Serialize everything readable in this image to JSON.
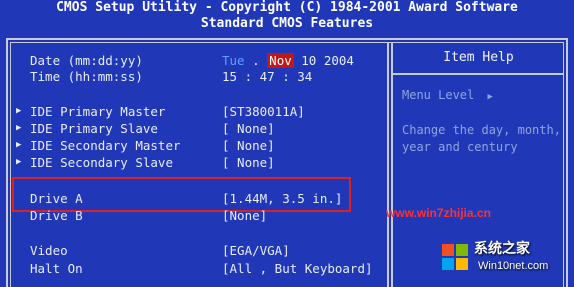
{
  "header": {
    "line1": "CMOS Setup Utility - Copyright (C) 1984-2001 Award Software",
    "line2": "Standard CMOS Features"
  },
  "settings": {
    "date_label": "Date (mm:dd:yy)",
    "date_day": "Tue",
    "date_month": "Nov",
    "date_rest": "10 2004",
    "time_label": "Time (hh:mm:ss)",
    "time_value": "15 : 47 : 34",
    "ide": [
      {
        "label": "IDE Primary Master",
        "value": "[ST380011A]"
      },
      {
        "label": "IDE Primary Slave",
        "value": "[ None]"
      },
      {
        "label": "IDE Secondary Master",
        "value": "[ None]"
      },
      {
        "label": "IDE Secondary Slave",
        "value": "[ None]"
      }
    ],
    "drive_a_label": "Drive A",
    "drive_a_value": "[1.44M, 3.5 in.]",
    "drive_b_label": "Drive B",
    "drive_b_value": "[None]",
    "video_label": "Video",
    "video_value": "[EGA/VGA]",
    "halt_label": "Halt On",
    "halt_value": "[All , But Keyboard]"
  },
  "help": {
    "title": "Item Help",
    "menu_level": "Menu Level",
    "menu_arrows": "▶",
    "desc_line1": "Change the day, month,",
    "desc_line2": "year and century"
  },
  "watermark": {
    "url": "www.win7zhijia.cn",
    "site_name": "系统之家",
    "site_url": "Win10net.com"
  },
  "colors": {
    "background": "#2038b8",
    "highlight_box": "#e02020",
    "month_highlight": "#c01818"
  }
}
